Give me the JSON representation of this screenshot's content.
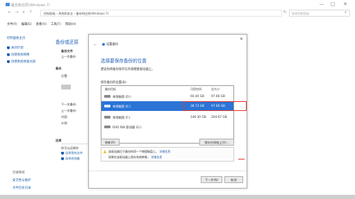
{
  "window": {
    "title": "备份和还原(Windows 7)",
    "controls": [
      "—",
      "□",
      "✕"
    ]
  },
  "addressbar": {
    "nav": [
      "←",
      "→",
      "∨",
      "↑"
    ],
    "path": "控制面板 › 系统和安全 › 备份和还原(Windows 7)",
    "refresh": "↻",
    "search_placeholder": "搜索控制面板",
    "search_icon": "magnifier-icon"
  },
  "menubar": [
    "文件(F)",
    "编辑(E)",
    "查看(V)",
    "工具(T)",
    "帮助(H)"
  ],
  "leftpane": {
    "home": "控制面板主页",
    "links": [
      "关闭计划",
      "创建系统映像",
      "创建系统修复光盘"
    ],
    "bottom_links": [
      "另请参阅",
      "安全性与维护",
      "文件历史记录"
    ]
  },
  "main": {
    "title": "备份或还原",
    "backup_heading": "备份",
    "lines": [
      "备份文件",
      "上一次备份",
      "位置:",
      "下一次备份:",
      "上一次备份:",
      "内容:",
      "计划:",
      "还原",
      "你可以还原你",
      "还原我的文件",
      "选择其他备"
    ]
  },
  "dialog": {
    "window_title": "设置备份",
    "heading": "选择要保存备份的位置",
    "subtitle": "建议你将备份保存在外部硬盘驱动器上。",
    "list_label": "保存备份的位置(B):",
    "columns": [
      "备份目标",
      "可用空间",
      "总大小"
    ],
    "rows": [
      {
        "name": "本地磁盘 (D:)",
        "free": "60.40 GB",
        "total": "97.66 GB"
      },
      {
        "name": "本地磁盘 (E:)",
        "free": "38.73 GB",
        "total": "97.66 GB"
      },
      {
        "name": "本地磁盘 (F:)",
        "free": "146.30 GB",
        "total": "204.67 GB"
      },
      {
        "name": "DVD RW 驱动器 (G:)",
        "free": "",
        "total": ""
      }
    ],
    "refresh_button": "刷新(R)",
    "network_button": "保存在网络上(V)...",
    "warning_line1": "该驱动器位于备份的同一个物理磁盘上。",
    "warning_link1": "详细信息",
    "warning_line2": "如果在该驱动器上保存系统映像，",
    "warning_link2": "详细信息",
    "next_button": "下一步(N)",
    "cancel_button": "取消"
  },
  "colors": {
    "accent": "#1f5fb5",
    "selection": "#2b74d6",
    "highlight_border": "#e8332a"
  }
}
